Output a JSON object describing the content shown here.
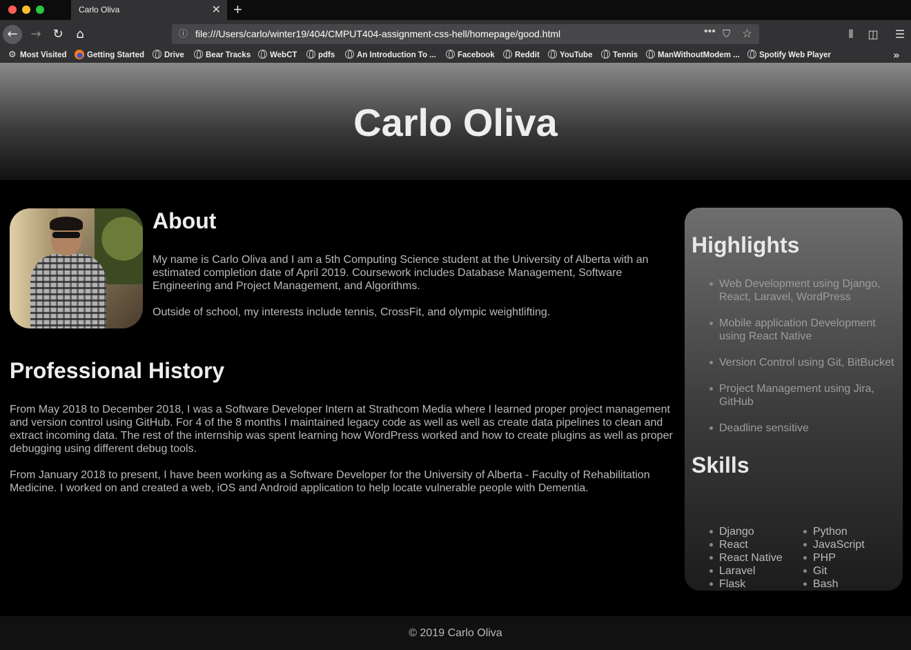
{
  "browser": {
    "tab_title": "Carlo Oliva",
    "tab_close": "✕",
    "new_tab": "+",
    "url": "file:///Users/carlo/winter19/404/CMPUT404-assignment-css-hell/homepage/good.html",
    "icons": {
      "back": "arrow-left-icon",
      "forward": "arrow-right-icon",
      "reload": "reload-icon",
      "home": "home-icon",
      "info": "info-icon",
      "more": "ellipsis-icon",
      "pocket": "pocket-icon",
      "star": "star-icon",
      "library": "library-icon",
      "sidebar": "sidebar-icon",
      "menu": "hamburger-icon"
    },
    "bookmarks": [
      "Most Visited",
      "Getting Started",
      "Drive",
      "Bear Tracks",
      "WebCT",
      "pdfs",
      "An Introduction To ...",
      "Facebook",
      "Reddit",
      "YouTube",
      "Tennis",
      "ManWithoutModem ...",
      "Spotify Web Player"
    ]
  },
  "header": {
    "title": "Carlo Oliva"
  },
  "about": {
    "title": "About",
    "paragraphs": [
      "My name is Carlo Oliva and I am a 5th Computing Science student at the University of Alberta with an estimated completion date of April 2019. Coursework includes Database Management, Software Engineering and Project Management, and Algorithms.",
      "Outside of school, my interests include tennis, CrossFit, and olympic weightlifting."
    ]
  },
  "history": {
    "title": "Professional History",
    "paragraphs": [
      "From May 2018 to December 2018, I was a Software Developer Intern at Strathcom Media where I learned proper project management and version control using GitHub. For 4 of the 8 months I maintained legacy code as well as well as create data pipelines to clean and extract incoming data. The rest of the internship was spent learning how WordPress worked and how to create plugins as well as proper debugging using different debug tools.",
      "From January 2018 to present, I have been working as a Software Developer for the University of Alberta - Faculty of Rehabilitation Medicine. I worked on and created a web, iOS and Android application to help locate vulnerable people with Dementia."
    ]
  },
  "aside": {
    "highlights_title": "Highlights",
    "highlights": [
      "Web Development using Django, React, Laravel, WordPress",
      "Mobile application Development using React Native",
      "Version Control using Git, BitBucket",
      "Project Management using Jira, GitHub",
      "Deadline sensitive"
    ],
    "skills_title": "Skills",
    "skills_col1": [
      "Django",
      "React",
      "React Native",
      "Laravel",
      "Flask"
    ],
    "skills_col2": [
      "Python",
      "JavaScript",
      "PHP",
      "Git",
      "Bash"
    ]
  },
  "footer": {
    "text": "© 2019 Carlo Oliva"
  },
  "colors": {
    "page_bg": "#000000",
    "chrome_bg": "#323234",
    "tab_strip": "#0c0c0d",
    "url_bar": "#474749",
    "footer_bg": "#111111"
  }
}
